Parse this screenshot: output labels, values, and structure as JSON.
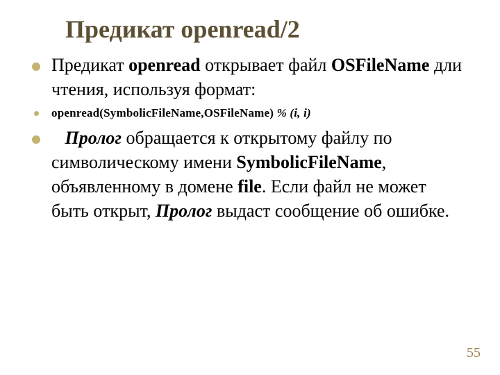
{
  "title": "Предикат openread/2",
  "items": [
    {
      "level": 1,
      "runs": [
        {
          "t": "Предикат "
        },
        {
          "t": "openread",
          "cls": "bold"
        },
        {
          "t": " открывает файл "
        },
        {
          "t": "OSFileName",
          "cls": "bold"
        },
        {
          "t": " дли чтения, используя формат:"
        }
      ]
    },
    {
      "level": 2,
      "runs": [
        {
          "t": "openread(SymbolicFileName,OSFileName) ",
          "cls": "bold"
        },
        {
          "t": "% (i, i)",
          "cls": "bolditalic"
        }
      ]
    },
    {
      "level": 1,
      "runs": [
        {
          "t": "   "
        },
        {
          "t": "Пролог",
          "cls": "bolditalic"
        },
        {
          "t": " обращается к открытому файлу по символическому имени "
        },
        {
          "t": "SymbolicFileName",
          "cls": "bold"
        },
        {
          "t": ", объявленному в домене "
        },
        {
          "t": "file",
          "cls": "bold"
        },
        {
          "t": ". Если файл не может быть открыт, "
        },
        {
          "t": "Пролог",
          "cls": "bolditalic"
        },
        {
          "t": " выдаст сообщение об ошибке."
        }
      ]
    }
  ],
  "page_number": "55"
}
